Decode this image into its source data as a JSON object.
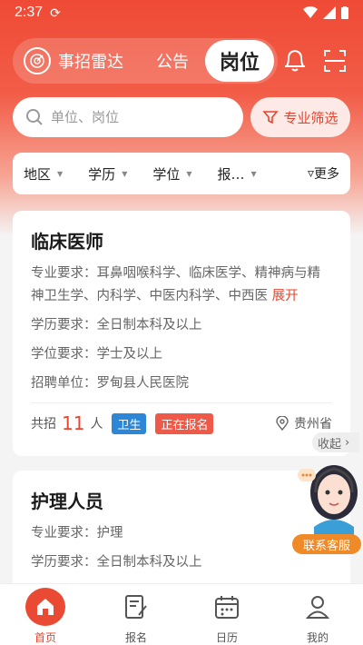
{
  "status": {
    "time": "2:37"
  },
  "topnav": {
    "logo_text": "事招雷达",
    "tab_notice": "公告",
    "tab_jobs": "岗位"
  },
  "search": {
    "placeholder": "单位、岗位"
  },
  "filter_button": "专业筛选",
  "filters": {
    "items": [
      "地区",
      "学历",
      "学位",
      "报…"
    ],
    "more": "更多"
  },
  "cards": [
    {
      "title": "临床医师",
      "major_label": "专业要求：",
      "major": "耳鼻咽喉科学、临床医学、精神病与精神卫生学、内科学、中医内科学、中西医",
      "expand": "展开",
      "edu_label": "学历要求：",
      "edu": "全日制本科及以上",
      "degree_label": "学位要求：",
      "degree": "学士及以上",
      "unit_label": "招聘单位：",
      "unit": "罗甸县人民医院",
      "total_prefix": "共招",
      "count": "11",
      "count_unit": "人",
      "tag_category": "卫生",
      "tag_status": "正在报名",
      "location": "贵州省"
    },
    {
      "title": "护理人员",
      "major_label": "专业要求：",
      "major": "护理",
      "edu_label": "学历要求：",
      "edu": "全日制本科及以上"
    }
  ],
  "widget": {
    "collapse": "收起",
    "service": "联系客服"
  },
  "bottomnav": {
    "items": [
      "首页",
      "报名",
      "日历",
      "我的"
    ]
  },
  "colors": {
    "brand_red": "#e8442e",
    "tag_blue": "#2d86d6",
    "service_orange": "#f08a28"
  }
}
